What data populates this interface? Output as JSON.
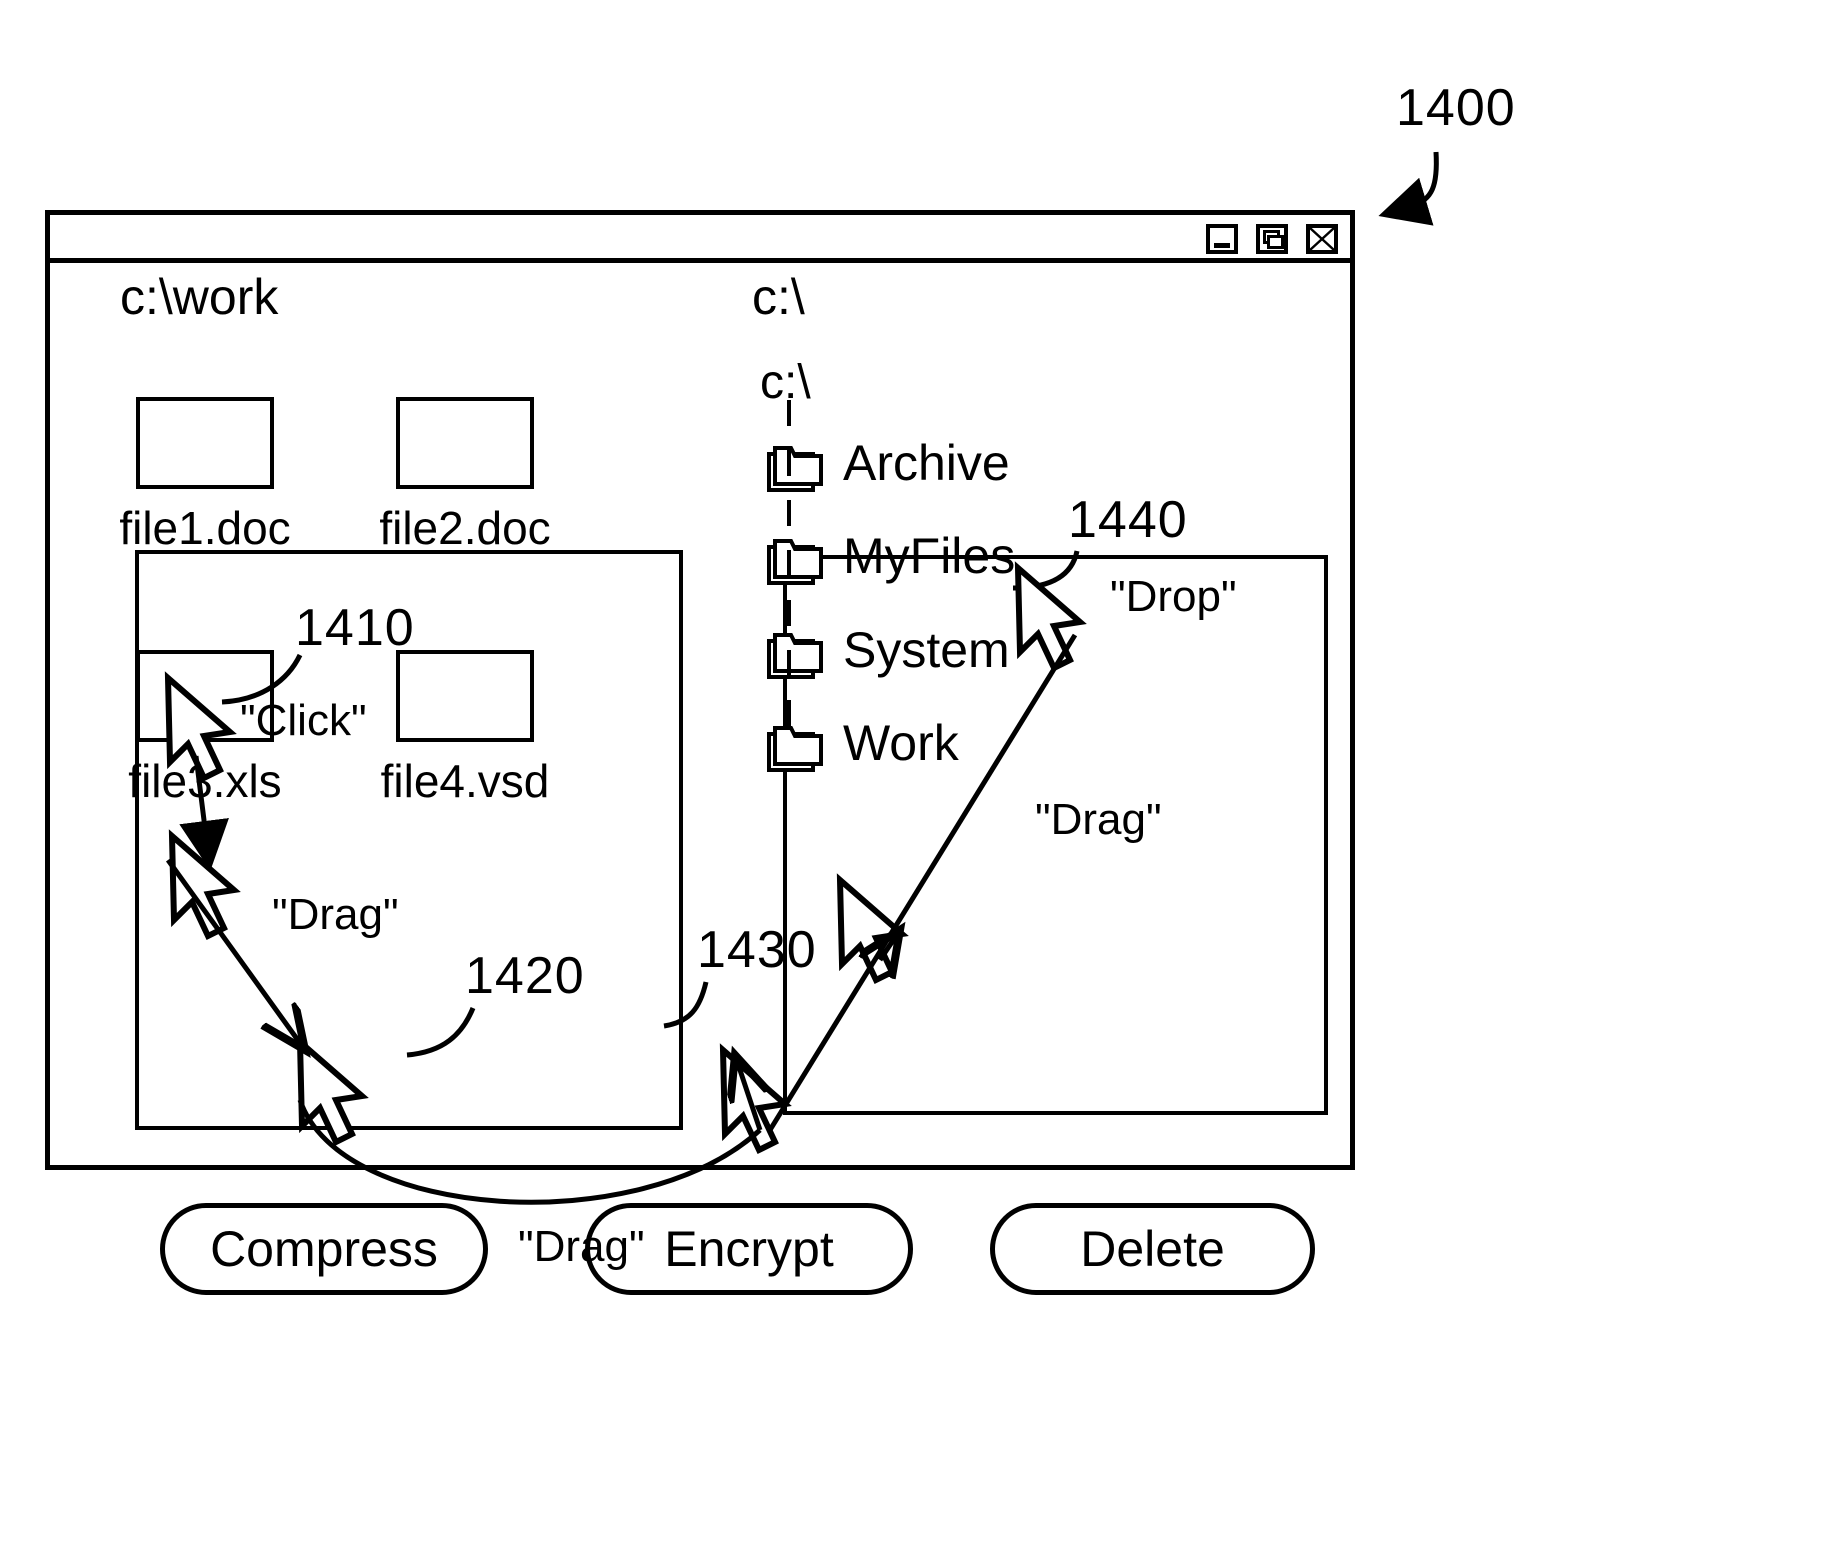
{
  "figure": {
    "number": "1400",
    "refs": {
      "file_icon": "1410",
      "compress_button": "1420",
      "encrypt_button": "1430",
      "myfiles_folder": "1440"
    }
  },
  "window": {
    "title_bar": {
      "minimize": "minimize-icon",
      "maximize": "restore-icon",
      "close": "close-icon"
    }
  },
  "left_pane": {
    "path_label": "c:\\work",
    "files": [
      {
        "name": "file1.doc",
        "icon": "document-icon"
      },
      {
        "name": "file2.doc",
        "icon": "document-icon"
      },
      {
        "name": "file3.xls",
        "icon": "spreadsheet-icon"
      },
      {
        "name": "file4.vsd",
        "icon": "diagram-icon"
      }
    ]
  },
  "right_pane": {
    "path_label": "c:\\",
    "tree_root": "c:\\",
    "folders": [
      {
        "name": "Archive",
        "icon": "folder-icon"
      },
      {
        "name": "MyFiles",
        "icon": "folder-icon"
      },
      {
        "name": "System",
        "icon": "folder-icon"
      },
      {
        "name": "Work",
        "icon": "folder-icon"
      }
    ]
  },
  "buttons": [
    {
      "label": "Compress"
    },
    {
      "label": "Encrypt"
    },
    {
      "label": "Delete"
    }
  ],
  "annotations": {
    "click": "\"Click\"",
    "drag_file_to_compress": "\"Drag\"",
    "drag_encrypt_to_myfiles": "\"Drag\"",
    "drag_bottom": "\"Drag\"",
    "drop": "\"Drop\""
  },
  "colors": {
    "ink": "#000000",
    "paper": "#ffffff"
  }
}
